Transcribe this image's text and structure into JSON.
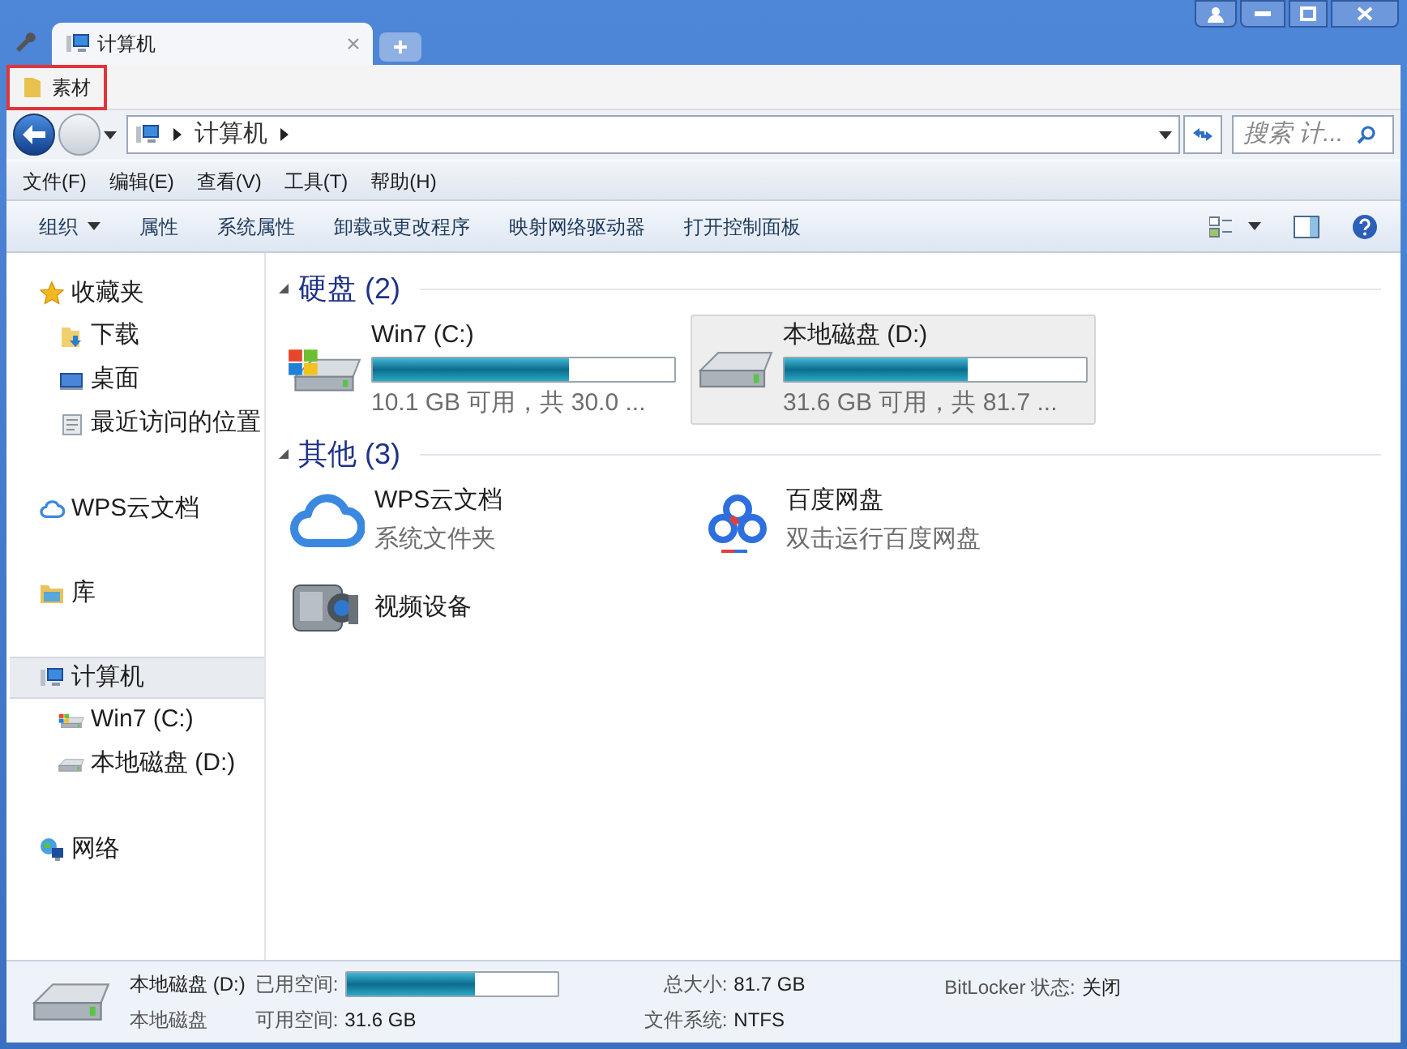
{
  "window": {
    "tab": "计算机",
    "favorites": [
      {
        "label": "素材",
        "highlighted": true
      }
    ]
  },
  "address": {
    "path": [
      "计算机"
    ],
    "search": {
      "placeholder": "搜索 计..."
    }
  },
  "menu": [
    "文件(F)",
    "编辑(E)",
    "查看(V)",
    "工具(T)",
    "帮助(H)"
  ],
  "toolbar": {
    "buttons": [
      {
        "label": "组织",
        "dropdown": true
      },
      {
        "label": "属性",
        "dropdown": false
      },
      {
        "label": "系统属性",
        "dropdown": false
      },
      {
        "label": "卸载或更改程序",
        "dropdown": false
      },
      {
        "label": "映射网络驱动器",
        "dropdown": false
      },
      {
        "label": "打开控制面板",
        "dropdown": false
      }
    ]
  },
  "sidebar": [
    {
      "label": "收藏夹",
      "kind": "star",
      "selected": false,
      "children": [
        {
          "label": "下载",
          "kind": "download",
          "selected": false
        },
        {
          "label": "桌面",
          "kind": "desktop",
          "selected": false
        },
        {
          "label": "最近访问的位置",
          "kind": "recent",
          "selected": false
        }
      ]
    },
    {
      "label": "WPS云文档",
      "kind": "cloud",
      "selected": false
    },
    {
      "label": "库",
      "kind": "library",
      "selected": false
    },
    {
      "label": "计算机",
      "kind": "computer",
      "selected": true,
      "children": [
        {
          "label": "Win7 (C:)",
          "kind": "system-drive",
          "selected": false
        },
        {
          "label": "本地磁盘 (D:)",
          "kind": "drive",
          "selected": false
        }
      ]
    },
    {
      "label": "网络",
      "kind": "network",
      "selected": false
    }
  ],
  "groups": [
    {
      "title": "硬盘 (2)",
      "items": [
        {
          "kind": "system-drive",
          "name": "Win7 (C:)",
          "level": 0.65,
          "detail": "10.1 GB 可用，共 30.0 ...",
          "selected": false
        },
        {
          "kind": "drive",
          "name": "本地磁盘 (D:)",
          "level": 0.61,
          "detail": "31.6 GB 可用，共 81.7 ...",
          "selected": true
        }
      ]
    },
    {
      "title": "其他 (3)",
      "items": [
        {
          "kind": "cloud",
          "name": "WPS云文档",
          "detail": "系统文件夹",
          "selected": false
        },
        {
          "kind": "baidu",
          "name": "百度网盘",
          "detail": "双击运行百度网盘",
          "selected": false
        },
        {
          "kind": "camera",
          "name": "视频设备",
          "selected": false
        }
      ]
    }
  ],
  "status": {
    "name": "本地磁盘 (D:)",
    "type": "本地磁盘",
    "level": 0.61,
    "used_label": "已用空间:",
    "free_label": "可用空间:",
    "free": "31.6 GB",
    "total_label": "总大小:",
    "total": "81.7 GB",
    "fs_label": "文件系统:",
    "fs": "NTFS",
    "bitlocker_label": "BitLocker 状态:",
    "bitlocker": "关闭"
  }
}
